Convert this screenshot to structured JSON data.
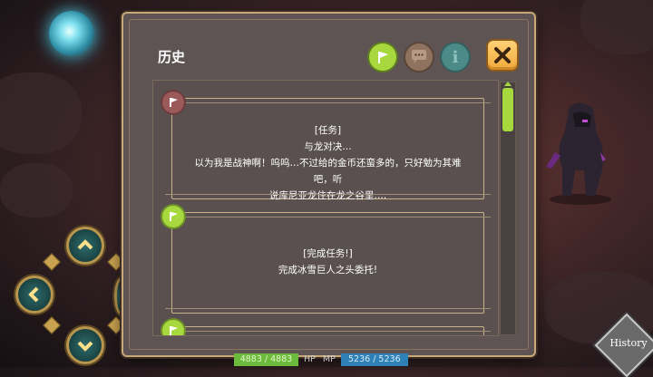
{
  "window": {
    "title": "历史"
  },
  "tabs": [
    {
      "name": "quest",
      "icon": "flag-icon",
      "active": true
    },
    {
      "name": "chat",
      "icon": "speech-bubble-icon",
      "active": false
    },
    {
      "name": "info",
      "icon": "info-icon",
      "glyph": "i",
      "active": false
    }
  ],
  "close_icon": "close-icon",
  "entries": [
    {
      "type": "task",
      "icon_color": "#9a5a5a",
      "lines": [
        "[任务]",
        "与龙对决…",
        "以为我是战神啊！呜呜…不过给的金币还蛮多的，只好勉为其难吧，听",
        "说库尼亚龙住在龙之谷里…."
      ]
    },
    {
      "type": "task-complete",
      "icon_color": "#a7d83d",
      "lines": [
        "[完成任务!]",
        "完成冰雪巨人之头委托!"
      ]
    },
    {
      "type": "partial",
      "icon_color": "#a7d83d",
      "lines": []
    }
  ],
  "status": {
    "hp_value": "4883 / 4883",
    "hp_label": "HP",
    "mp_label": "MP",
    "mp_value": "5236 / 5236"
  },
  "history_button": {
    "label": "History"
  },
  "colors": {
    "accent_green": "#a7d83d",
    "close_orange": "#f0a93a",
    "panel_bg": "#5e5454",
    "border_gold": "#c9a878"
  }
}
